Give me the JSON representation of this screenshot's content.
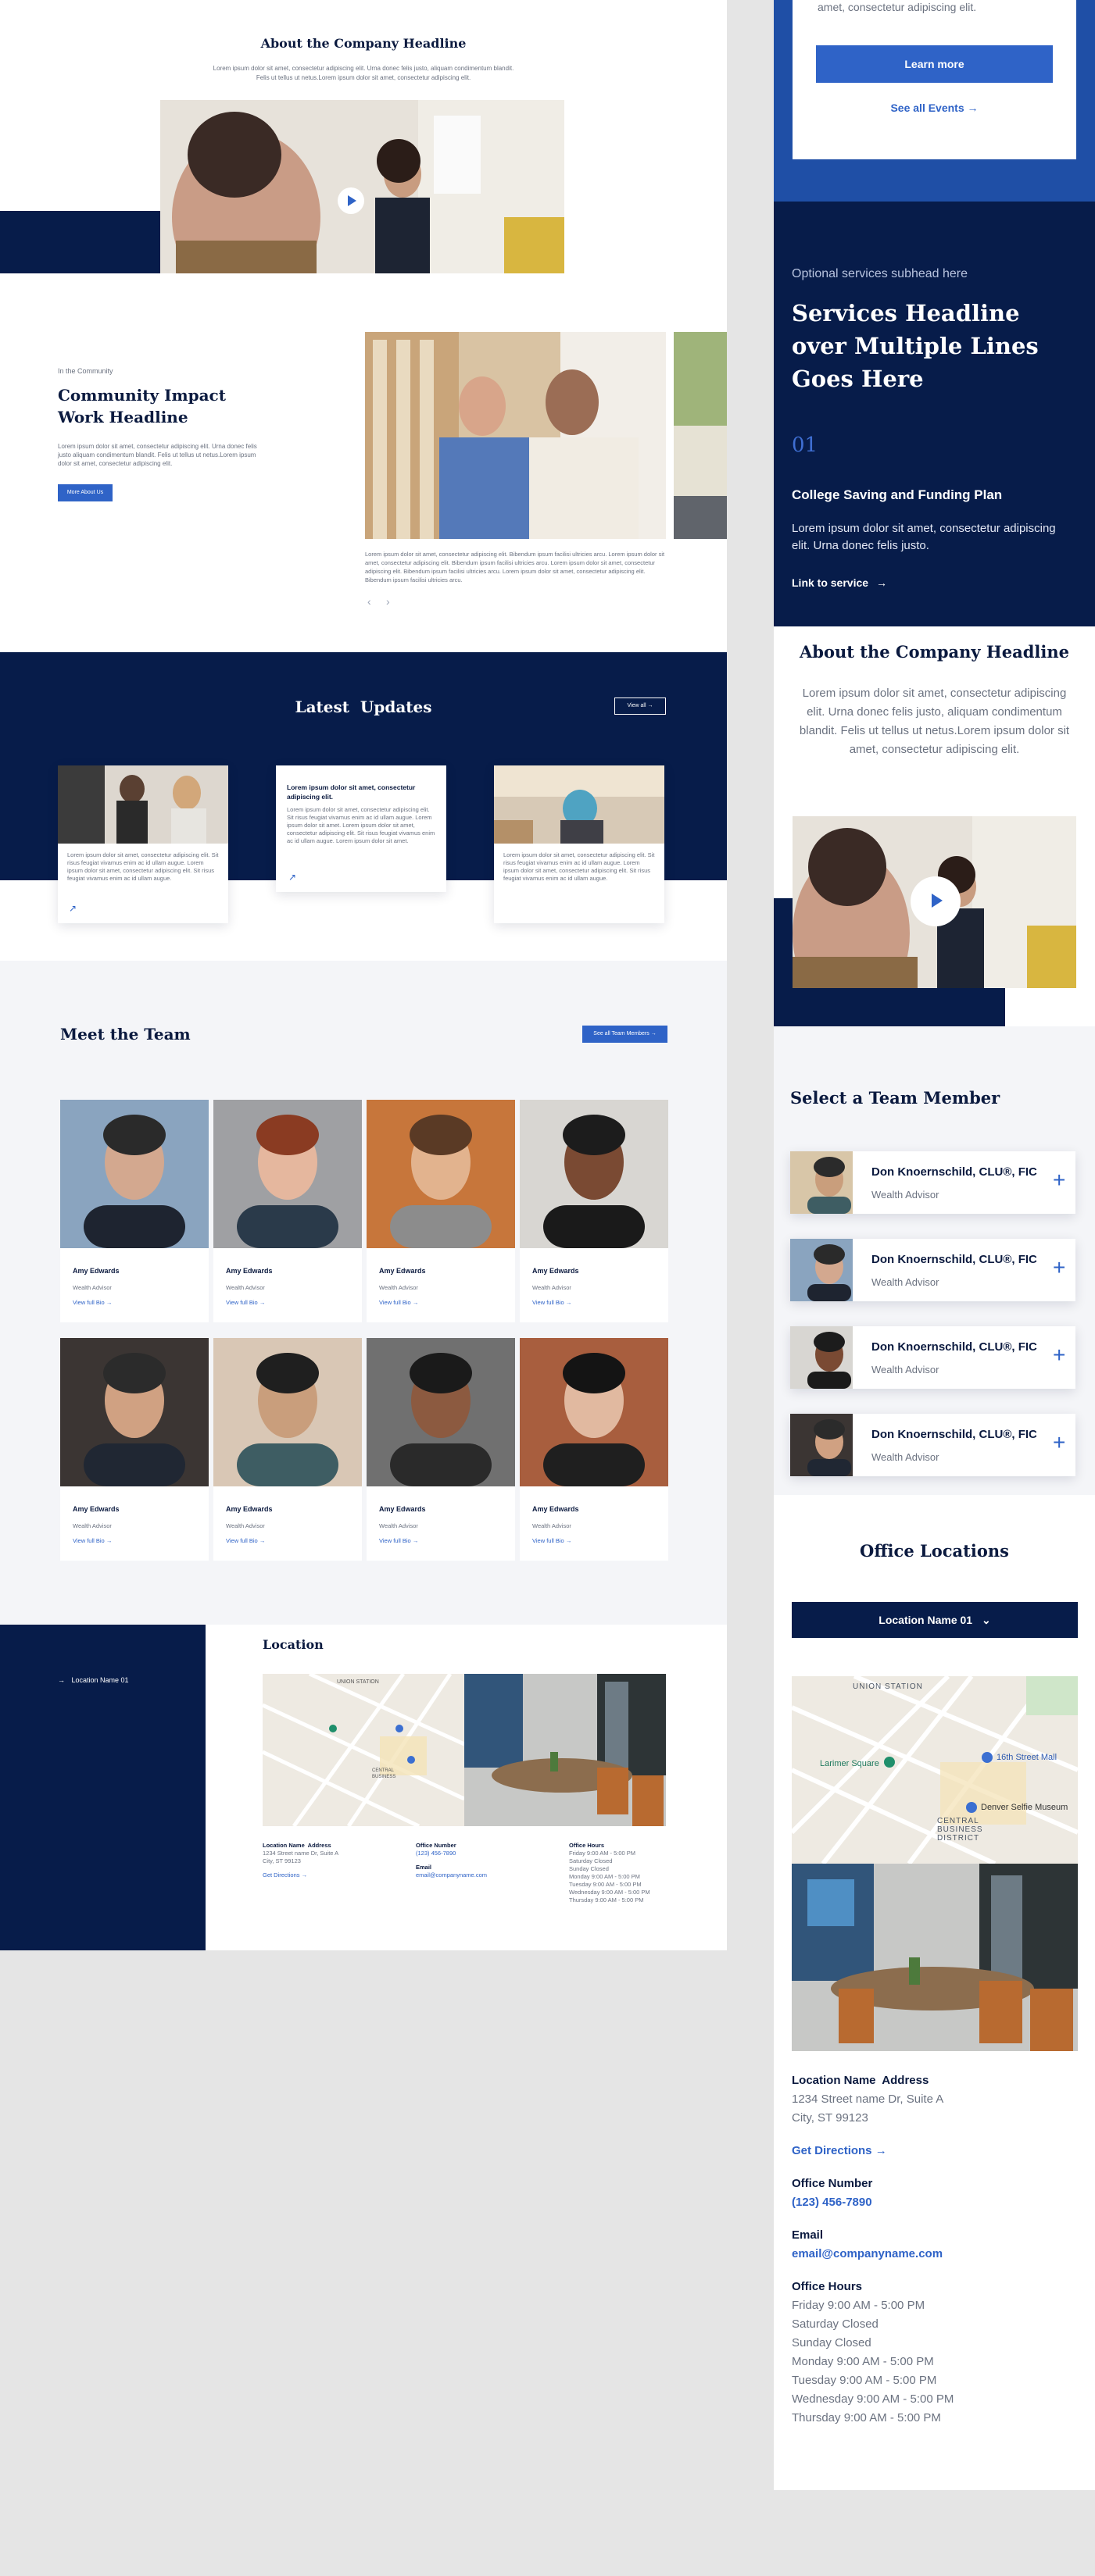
{
  "colors": {
    "navy": "#071c4a",
    "accent": "#2f63c7",
    "light_bg": "#f4f5f8",
    "page_bg": "#e5e5e5"
  },
  "desktop": {
    "about": {
      "title": "About the Company Headline",
      "body_line1": "Lorem ipsum dolor sit amet, consectetur adipiscing elit. Urna donec felis justo, aliquam condimentum blandit.",
      "body_line2": "Felis ut tellus ut netus.Lorem ipsum dolor sit amet, consectetur adipiscing elit.",
      "play_icon": "play-icon"
    },
    "community": {
      "eyebrow": "In the Community",
      "title_line1": "Community Impact",
      "title_line2": "Work Headline",
      "body": "Lorem ipsum dolor sit amet, consectetur adipiscing elit. Urna donec felis justo aliquam condimentum blandit. Felis ut tellus ut netus.Lorem ipsum dolor sit amet, consectetur adipiscing elit.",
      "button": "More About Us",
      "caption": "Lorem ipsum dolor sit amet, consectetur adipiscing elit. Bibendum ipsum facilisi ultricies arcu. Lorem ipsum dolor sit amet, consectetur adipiscing elit. Bibendum ipsum facilisi ultricies arcu. Lorem ipsum dolor sit amet, consectetur adipiscing elit. Bibendum ipsum facilisi ultricies arcu. Lorem ipsum dolor sit amet, consectetur adipiscing elit. Bibendum ipsum facilisi ultricies arcu.",
      "prev_icon": "chevron-left-icon",
      "next_icon": "chevron-right-icon"
    },
    "updates": {
      "title": "Latest  Updates",
      "view_all": "View all",
      "cards": [
        {
          "heading": "",
          "body": "Lorem ipsum dolor sit amet, consectetur adipiscing elit. Sit risus feugiat vivamus enim ac id ullam augue. Lorem ipsum dolor sit amet, consectetur adipiscing elit. Sit risus feugiat vivamus enim ac id ullam augue."
        },
        {
          "heading": "Lorem ipsum dolor sit amet, consectetur adipiscing elit.",
          "body": "Lorem ipsum dolor sit amet, consectetur adipiscing elit. Sit risus feugiat vivamus enim ac id ullam augue. Lorem ipsum dolor sit amet. Lorem ipsum dolor sit amet, consectetur adipiscing elit. Sit risus feugiat vivamus enim ac id ullam augue. Lorem ipsum dolor sit amet."
        },
        {
          "heading": "",
          "body": "Lorem ipsum dolor sit amet, consectetur adipiscing elit. Sit risus feugiat vivamus enim ac id ullam augue. Lorem ipsum dolor sit amet, consectetur adipiscing elit. Sit risus feugiat vivamus enim ac id ullam augue."
        }
      ]
    },
    "team": {
      "title": "Meet the Team",
      "see_all": "See all Team Members",
      "members": [
        {
          "name": "Amy Edwards",
          "role": "Wealth Advisor",
          "link": "View full Bio"
        },
        {
          "name": "Amy Edwards",
          "role": "Wealth Advisor",
          "link": "View full Bio"
        },
        {
          "name": "Amy Edwards",
          "role": "Wealth Advisor",
          "link": "View full Bio"
        },
        {
          "name": "Amy Edwards",
          "role": "Wealth Advisor",
          "link": "View full Bio"
        },
        {
          "name": "Amy Edwards",
          "role": "Wealth Advisor",
          "link": "View full Bio"
        },
        {
          "name": "Amy Edwards",
          "role": "Wealth Advisor",
          "link": "View full Bio"
        },
        {
          "name": "Amy Edwards",
          "role": "Wealth Advisor",
          "link": "View full Bio"
        },
        {
          "name": "Amy Edwards",
          "role": "Wealth Advisor",
          "link": "View full Bio"
        }
      ]
    },
    "location": {
      "sidebar_item": "Location Name 01",
      "title": "Location",
      "address_label": "Location Name  Address",
      "address_line1": "1234 Street name Dr, Suite A",
      "address_line2": "City, ST 99123",
      "directions": "Get Directions",
      "office_label": "Office Number",
      "office_value": "(123) 456-7890",
      "email_label": "Email",
      "email_value": "email@companyname.com",
      "hours_label": "Office Hours",
      "hours": [
        "Friday 9:00 AM - 5:00 PM",
        "Saturday Closed",
        "Sunday Closed",
        "Monday 9:00 AM - 5:00 PM",
        "Tuesday 9:00 AM - 5:00 PM",
        "Wednesday 9:00 AM - 5:00 PM",
        "Thursday 9:00 AM - 5:00 PM"
      ]
    }
  },
  "mobile": {
    "events": {
      "text": "amet, consectetur adipiscing elit.",
      "learn_more": "Learn more",
      "see_all": "See all Events"
    },
    "services": {
      "subhead": "Optional services subhead here",
      "title": "Services Headline over Multiple Lines Goes Here",
      "number": "01",
      "item_title": "College Saving and Funding Plan",
      "item_body": "Lorem ipsum dolor sit amet, consectetur adipiscing elit. Urna donec felis justo.",
      "link": "Link to service"
    },
    "about": {
      "title": "About the Company Headline",
      "body": "Lorem ipsum dolor sit amet, consectetur adipiscing elit. Urna donec felis justo, aliquam condimentum blandit. Felis ut tellus ut netus.Lorem ipsum dolor sit amet, consectetur adipiscing elit."
    },
    "team": {
      "title": "Select a Team Member",
      "members": [
        {
          "name": "Don Knoernschild, CLU®, FIC",
          "role": "Wealth Advisor"
        },
        {
          "name": "Don Knoernschild, CLU®, FIC",
          "role": "Wealth Advisor"
        },
        {
          "name": "Don Knoernschild, CLU®, FIC",
          "role": "Wealth Advisor"
        },
        {
          "name": "Don Knoernschild, CLU®, FIC",
          "role": "Wealth Advisor"
        }
      ]
    },
    "offices": {
      "title": "Office Locations",
      "dropdown": "Location Name 01",
      "map_labels": [
        "UNION STATION",
        "Larimer Square",
        "16th Street Mall",
        "Denver Selfie Museum",
        "CENTRAL BUSINESS DISTRICT"
      ],
      "address_label": "Location Name  Address",
      "address_line1": "1234 Street name Dr, Suite A",
      "address_line2": "City, ST 99123",
      "directions": "Get Directions",
      "office_label": "Office Number",
      "office_value": "(123) 456-7890",
      "email_label": "Email",
      "email_value": "email@companyname.com",
      "hours_label": "Office Hours",
      "hours": [
        "Friday 9:00 AM - 5:00 PM",
        "Saturday Closed",
        "Sunday Closed",
        "Monday 9:00 AM - 5:00 PM",
        "Tuesday 9:00 AM - 5:00 PM",
        "Wednesday 9:00 AM - 5:00 PM",
        "Thursday 9:00 AM - 5:00 PM"
      ]
    }
  }
}
